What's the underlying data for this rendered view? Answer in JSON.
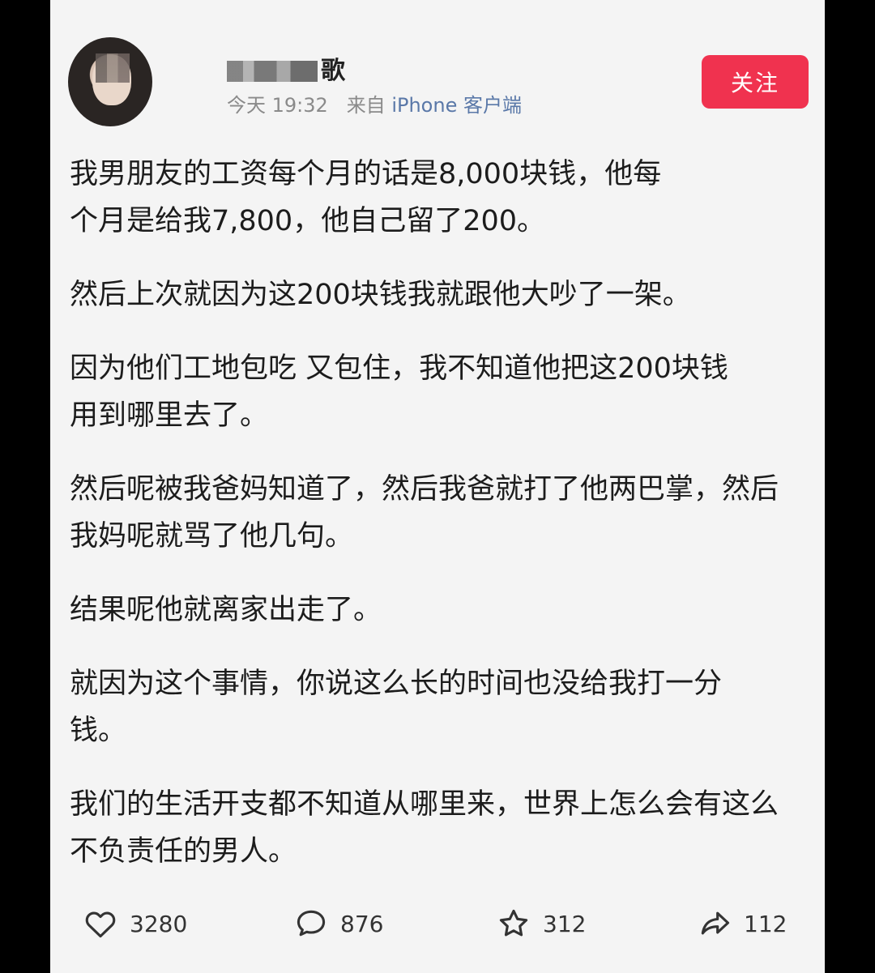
{
  "post": {
    "username_visible": "歌",
    "time": "今天 19:32",
    "source_prefix": "来自",
    "source": "iPhone 客户端",
    "follow_label": "关注"
  },
  "paragraphs": [
    "我男朋友的工资每个月的话是8,000块钱，他每个月是给我7,800，他自己留了200。",
    "然后上次就因为这200块钱我就跟他大吵了一架。",
    "因为他们工地包吃 又包住，我不知道他把这200块钱用到哪里去了。",
    "然后呢被我爸妈知道了，然后我爸就打了他两巴掌，然后我妈呢就骂了他几句。",
    "结果呢他就离家出走了。",
    "就因为这个事情，你说这么长的时间也没给我打一分钱。",
    "我们的生活开支都不知道从哪里来，世界上怎么会有这么不负责任的男人。"
  ],
  "stats": {
    "likes": "3280",
    "comments": "876",
    "favorites": "312",
    "shares": "112"
  },
  "colors": {
    "follow_button": "#f0324f",
    "source_link": "#5a78a8"
  }
}
